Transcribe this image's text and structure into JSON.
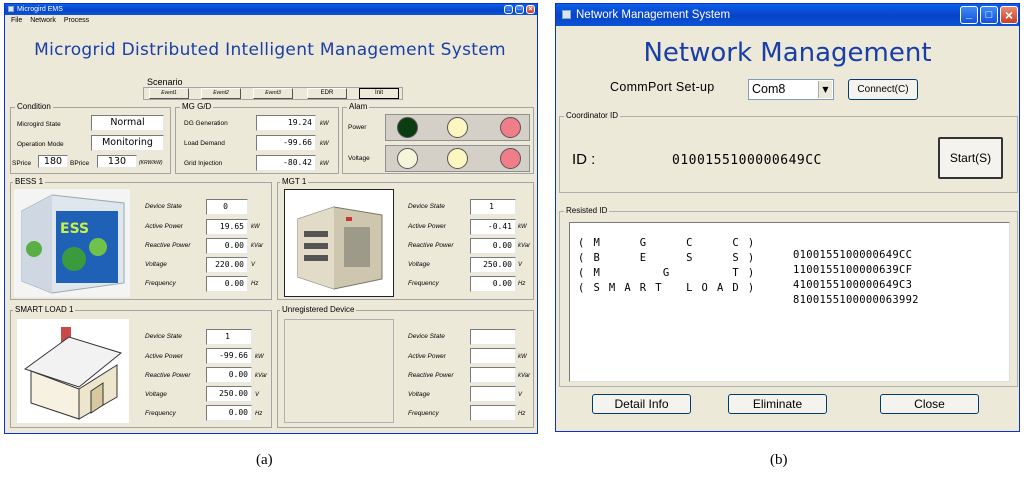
{
  "window_a": {
    "title": "Microgird EMS",
    "menu": [
      "File",
      "Network",
      "Process"
    ],
    "app_title": "Microgrid Distributed Intelligent Management System",
    "scenario": {
      "label": "Scenario",
      "buttons": [
        "Event1",
        "Event2",
        "Event3",
        "EDR",
        "Init"
      ]
    },
    "condition": {
      "label": "Condition",
      "state_label": "Microgird State",
      "state_value": "Normal",
      "mode_label": "Operation Mode",
      "mode_value": "Monitoring",
      "sprice_label": "SPrice",
      "sprice_value": "180",
      "bprice_label": "BPrice",
      "bprice_value": "130",
      "price_unit": "(KRW/kW)"
    },
    "mg": {
      "label": "MG G/D",
      "rows": [
        {
          "label": "DG Generation",
          "value": "19.24",
          "unit": "kW"
        },
        {
          "label": "Load Demand",
          "value": "-99.66",
          "unit": "kW"
        },
        {
          "label": "Grid Injection",
          "value": "-80.42",
          "unit": "kW"
        }
      ]
    },
    "alarm": {
      "label": "Alam",
      "power_label": "Power",
      "voltage_label": "Voltage",
      "power_leds": [
        "#0a3d12",
        "#fdf6c0",
        "#f07e88"
      ],
      "voltage_leds": [
        "#f4f6dc",
        "#fdf6c0",
        "#f07e88"
      ]
    },
    "bess": {
      "label": "BESS 1",
      "image_text": "ESS",
      "rows": [
        {
          "label": "Device State",
          "value": "0",
          "unit": ""
        },
        {
          "label": "Active Power",
          "value": "19.65",
          "unit": "kW"
        },
        {
          "label": "Reactive Power",
          "value": "0.00",
          "unit": "kVar"
        },
        {
          "label": "Voltage",
          "value": "220.00",
          "unit": "V"
        },
        {
          "label": "Frequency",
          "value": "0.00",
          "unit": "Hz"
        }
      ]
    },
    "mgt": {
      "label": "MGT 1",
      "rows": [
        {
          "label": "Device State",
          "value": "1",
          "unit": ""
        },
        {
          "label": "Active Power",
          "value": "-0.41",
          "unit": "kW"
        },
        {
          "label": "Reactive Power",
          "value": "0.00",
          "unit": "kVar"
        },
        {
          "label": "Voltage",
          "value": "250.00",
          "unit": "V"
        },
        {
          "label": "Frequency",
          "value": "0.00",
          "unit": "Hz"
        }
      ]
    },
    "smart_load": {
      "label": "SMART LOAD 1",
      "rows": [
        {
          "label": "Device State",
          "value": "1",
          "unit": ""
        },
        {
          "label": "Active Power",
          "value": "-99.66",
          "unit": "kW"
        },
        {
          "label": "Reactive Power",
          "value": "0.00",
          "unit": "kVar"
        },
        {
          "label": "Voltage",
          "value": "250.00",
          "unit": "V"
        },
        {
          "label": "Frequency",
          "value": "0.00",
          "unit": "Hz"
        }
      ]
    },
    "unregistered": {
      "label": "Unregistered Device",
      "rows": [
        {
          "label": "Device State",
          "value": "",
          "unit": ""
        },
        {
          "label": "Active Power",
          "value": "",
          "unit": "kW"
        },
        {
          "label": "Reactive Power",
          "value": "",
          "unit": "kVar"
        },
        {
          "label": "Voltage",
          "value": "",
          "unit": "V"
        },
        {
          "label": "Frequency",
          "value": "",
          "unit": "Hz"
        }
      ]
    }
  },
  "window_b": {
    "title": "Network Management System",
    "app_title": "Network Management",
    "commport_label": "CommPort Set-up",
    "commport_value": "Com8",
    "connect_label": "Connect(C)",
    "coordinator_label": "Coordinator ID",
    "id_label": "ID :",
    "id_value": "0100155100000649CC",
    "start_label": "Start(S)",
    "registered_label": "Resisted ID",
    "registered": [
      {
        "name": "( M     G     C     C )",
        "id": "0100155100000649CC"
      },
      {
        "name": "( B     E     S     S )",
        "id": "1100155100000639CF"
      },
      {
        "name": "( M        G        T )",
        "id": "4100155100000649C3"
      },
      {
        "name": "( S M A R T   L O A D )",
        "id": "8100155100000063992"
      }
    ],
    "detail_label": "Detail Info",
    "eliminate_label": "Eliminate",
    "close_label": "Close"
  },
  "captions": {
    "a": "(a)",
    "b": "(b)"
  },
  "colors": {
    "accent_title": "#1a3ea8",
    "window_bg": "#ece9d8",
    "titlebar": "#0843c9"
  }
}
